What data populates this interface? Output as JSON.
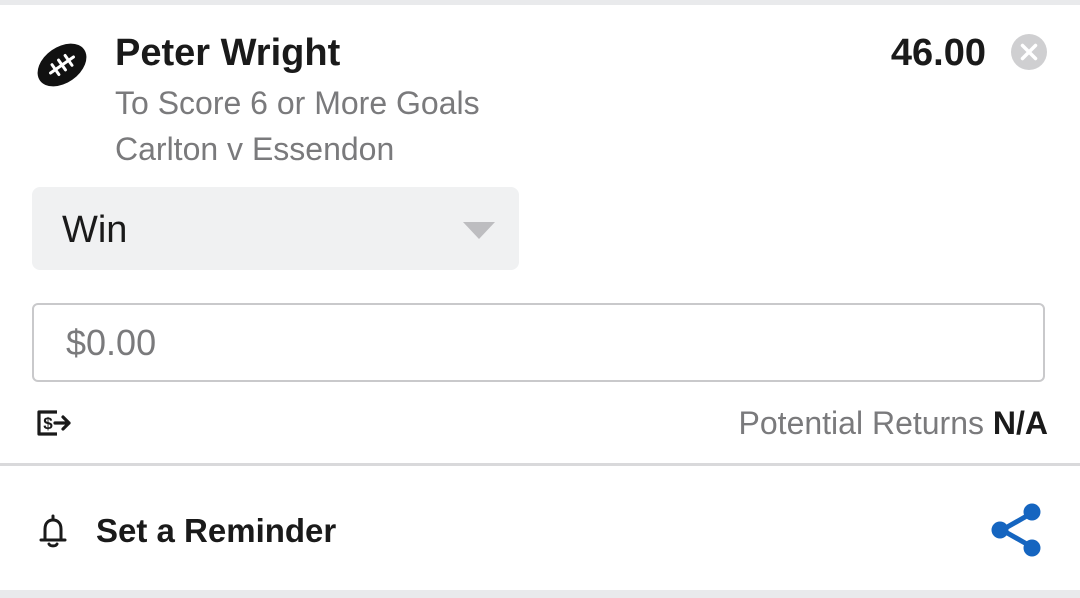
{
  "selection": {
    "runner": "Peter Wright",
    "odds": "46.00",
    "market": "To Score 6 or More Goals",
    "event": "Carlton v Essendon",
    "sport_icon": "football-icon",
    "remove_icon": "close-icon"
  },
  "bet_type": {
    "selected": "Win",
    "caret_icon": "chevron-down-icon"
  },
  "stake": {
    "placeholder": "$0.00",
    "value": ""
  },
  "returns": {
    "icon": "cash-icon",
    "label": "Potential Returns",
    "value": "N/A"
  },
  "reminder": {
    "icon": "bell-icon",
    "label": "Set a Reminder"
  },
  "share": {
    "icon": "share-icon"
  },
  "colors": {
    "text_primary": "#1a1a1a",
    "text_secondary": "#7a7a7c",
    "accent": "#1565c0",
    "dropdown_bg": "#f0f1f2",
    "page_bg": "#e9eaec"
  }
}
